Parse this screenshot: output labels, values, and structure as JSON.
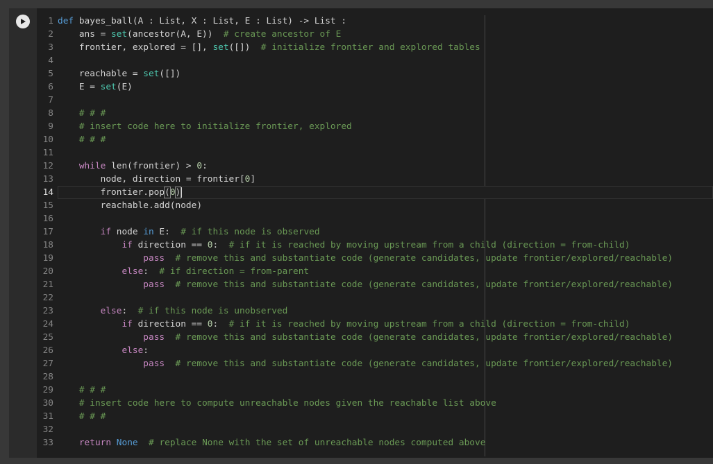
{
  "run_button": {
    "icon": "play-icon"
  },
  "colors": {
    "keyword": "#569cd6",
    "control": "#c586c0",
    "builtin": "#4ec9b0",
    "comment": "#6a9955",
    "number": "#b5cea8",
    "text": "#d4d4d4"
  },
  "active_line": 14,
  "code": {
    "l1": {
      "n": "1",
      "a": "def",
      "b": " bayes_ball(A : List, X : List, E : List) -> List :"
    },
    "l2": {
      "n": "2",
      "a": "    ans = ",
      "b": "set",
      "c": "(ancestor(A, E))  ",
      "d": "# create ancestor of E"
    },
    "l3": {
      "n": "3",
      "a": "    frontier, explored = [], ",
      "b": "set",
      "c": "([])  ",
      "d": "# initialize frontier and explored tables"
    },
    "l4": {
      "n": "4"
    },
    "l5": {
      "n": "5",
      "a": "    reachable = ",
      "b": "set",
      "c": "([])"
    },
    "l6": {
      "n": "6",
      "a": "    E = ",
      "b": "set",
      "c": "(E)"
    },
    "l7": {
      "n": "7"
    },
    "l8": {
      "n": "8",
      "a": "    ",
      "d": "# # #"
    },
    "l9": {
      "n": "9",
      "a": "    ",
      "d": "# insert code here to initialize frontier, explored"
    },
    "l10": {
      "n": "10",
      "a": "    ",
      "d": "# # #"
    },
    "l11": {
      "n": "11"
    },
    "l12": {
      "n": "12",
      "a": "    ",
      "k": "while",
      "b": " len(frontier) > ",
      "num": "0",
      "c": ":"
    },
    "l13": {
      "n": "13",
      "a": "        node, direction = frontier[",
      "num": "0",
      "c": "]"
    },
    "l14": {
      "n": "14",
      "a": "        frontier.pop",
      "p1": "(",
      "num": "0",
      "p2": ")"
    },
    "l15": {
      "n": "15",
      "a": "        reachable.add(node)"
    },
    "l16": {
      "n": "16"
    },
    "l17": {
      "n": "17",
      "a": "        ",
      "k": "if",
      "b": " node ",
      "k2": "in",
      "c": " E:  ",
      "d": "# if this node is observed"
    },
    "l18": {
      "n": "18",
      "a": "            ",
      "k": "if",
      "b": " direction == ",
      "num": "0",
      "c": ":  ",
      "d": "# if it is reached by moving upstream from a child (direction = from-child)"
    },
    "l19": {
      "n": "19",
      "a": "                ",
      "k": "pass",
      "c": "  ",
      "d": "# remove this and substantiate code (generate candidates, update frontier/explored/reachable)"
    },
    "l20": {
      "n": "20",
      "a": "            ",
      "k": "else",
      "c": ":  ",
      "d": "# if direction = from-parent"
    },
    "l21": {
      "n": "21",
      "a": "                ",
      "k": "pass",
      "c": "  ",
      "d": "# remove this and substantiate code (generate candidates, update frontier/explored/reachable)"
    },
    "l22": {
      "n": "22"
    },
    "l23": {
      "n": "23",
      "a": "        ",
      "k": "else",
      "c": ":  ",
      "d": "# if this node is unobserved"
    },
    "l24": {
      "n": "24",
      "a": "            ",
      "k": "if",
      "b": " direction == ",
      "num": "0",
      "c": ":  ",
      "d": "# if it is reached by moving upstream from a child (direction = from-child)"
    },
    "l25": {
      "n": "25",
      "a": "                ",
      "k": "pass",
      "c": "  ",
      "d": "# remove this and substantiate code (generate candidates, update frontier/explored/reachable)"
    },
    "l26": {
      "n": "26",
      "a": "            ",
      "k": "else",
      "c": ":"
    },
    "l27": {
      "n": "27",
      "a": "                ",
      "k": "pass",
      "c": "  ",
      "d": "# remove this and substantiate code (generate candidates, update frontier/explored/reachable)"
    },
    "l28": {
      "n": "28"
    },
    "l29": {
      "n": "29",
      "a": "    ",
      "d": "# # #"
    },
    "l30": {
      "n": "30",
      "a": "    ",
      "d": "# insert code here to compute unreachable nodes given the reachable list above"
    },
    "l31": {
      "n": "31",
      "a": "    ",
      "d": "# # #"
    },
    "l32": {
      "n": "32"
    },
    "l33": {
      "n": "33",
      "a": "    ",
      "k": "return",
      "b": " ",
      "kn": "None",
      "c": "  ",
      "d": "# replace None with the set of unreachable nodes computed above"
    }
  }
}
